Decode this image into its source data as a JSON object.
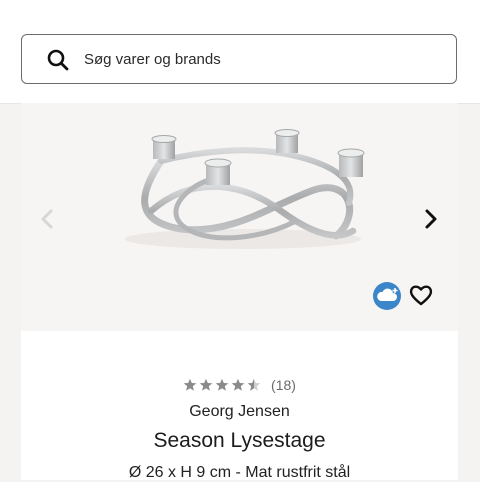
{
  "search": {
    "placeholder": "Søg varer og brands",
    "icon": "search-icon"
  },
  "gallery": {
    "prev_icon": "chevron-left-icon",
    "next_icon": "chevron-right-icon",
    "badge_icon": "cloud-plus-icon",
    "favorite_icon": "heart-icon"
  },
  "product": {
    "rating": 4.5,
    "rating_max": 5,
    "review_count": "(18)",
    "brand": "Georg Jensen",
    "name": "Season Lysestage",
    "description": "Ø 26 x H 9 cm - Mat rustfrit stål"
  },
  "colors": {
    "star": "#8a8a8a",
    "star_empty": "#cfcfcf",
    "badge": "#3a86c8"
  }
}
